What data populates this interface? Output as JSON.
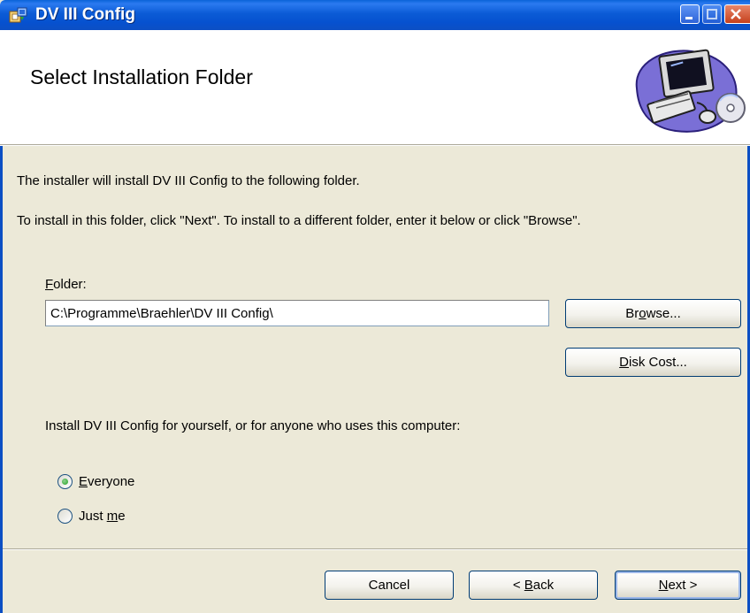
{
  "window": {
    "title": "DV III Config"
  },
  "banner": {
    "title": "Select Installation Folder"
  },
  "body": {
    "intro_line": "The installer will install DV III Config to the following folder.",
    "instruction_line": "To install in this folder, click \"Next\". To install to a different folder, enter it below or click \"Browse\".",
    "folder_label_accel": "F",
    "folder_label_rest": "older:",
    "folder_value": "C:\\Programme\\Braehler\\DV III Config\\",
    "browse_pre": "Br",
    "browse_accel": "o",
    "browse_post": "wse...",
    "disk_cost_accel": "D",
    "disk_cost_post": "isk Cost...",
    "scope_question": "Install DV III Config for yourself, or for anyone who uses this computer:",
    "radio_everyone_accel": "E",
    "radio_everyone_post": "veryone",
    "radio_justme_pre": "Just ",
    "radio_justme_accel": "m",
    "radio_justme_post": "e",
    "selected_option": "Everyone"
  },
  "footer": {
    "cancel": "Cancel",
    "back_pre": "< ",
    "back_accel": "B",
    "back_post": "ack",
    "next_accel": "N",
    "next_post": "ext >"
  },
  "colors": {
    "titlebar": "#0651cf",
    "face": "#ece9d8",
    "radio_dot": "#21a121"
  }
}
